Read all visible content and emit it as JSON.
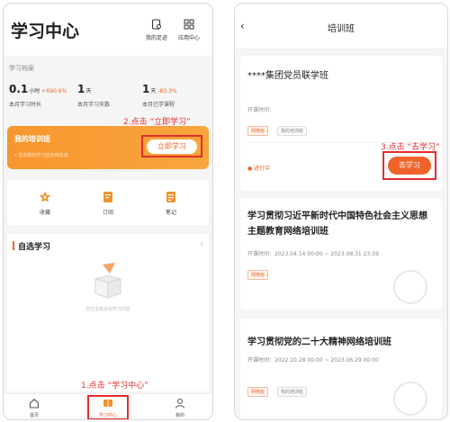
{
  "left": {
    "title": "学习中心",
    "header_buttons": [
      {
        "label": "我的足迹",
        "icon": "footprint-icon"
      },
      {
        "label": "应用中心",
        "icon": "grid-icon"
      }
    ],
    "archive_label": "学习档案",
    "stats": [
      {
        "value": "0.1",
        "unit": "小时",
        "delta": "+690.6%",
        "label": "本月学习时长"
      },
      {
        "value": "1",
        "unit": "天",
        "delta": "",
        "label": "本月学习天数"
      },
      {
        "value": "1",
        "unit": "天",
        "delta": "-83.3%",
        "label": "本月已学课程"
      }
    ],
    "step2": "2.点击 “立即学习”",
    "training_card": {
      "title": "我的培训班",
      "subtitle": "• 您有新的学习任务待完成",
      "button": "立即学习"
    },
    "quick_items": [
      {
        "label": "收藏",
        "icon": "star-icon"
      },
      {
        "label": "订阅",
        "icon": "subscribe-icon"
      },
      {
        "label": "笔记",
        "icon": "note-icon"
      }
    ],
    "optional": {
      "title": "自选学习",
      "empty_text": "您还没有添加学习内容"
    },
    "step1": "1.点击 “学习中心”",
    "tabs": [
      {
        "label": "首页",
        "icon": "home-icon"
      },
      {
        "label": "学习中心",
        "icon": "book-icon"
      },
      {
        "label": "我的",
        "icon": "user-icon"
      }
    ],
    "accent": "#f0632a",
    "highlight": "#e52d2d"
  },
  "right": {
    "title": "培训班",
    "step3": "3.点击 “去学习”",
    "courses": [
      {
        "title": "****集团党员联学班",
        "time": "开课时间：",
        "tags": [
          "网络班",
          "我的培训班"
        ],
        "status": "进行中",
        "button": "去学习"
      },
      {
        "title": "学习贯彻习近平新时代中国特色社会主义思想主题教育网络培训班",
        "time": "开课时间：2023.04.14 00:00 ~ 2023.08.31 23:59",
        "tags": [
          "网络班"
        ]
      },
      {
        "title": "学习贯彻党的二十大精神网络培训班",
        "time": "开课时间：2022.10.28 00:00 ~ 2023.06.29 00:00",
        "tags": [
          "网络班",
          "我的培训班"
        ]
      }
    ]
  }
}
